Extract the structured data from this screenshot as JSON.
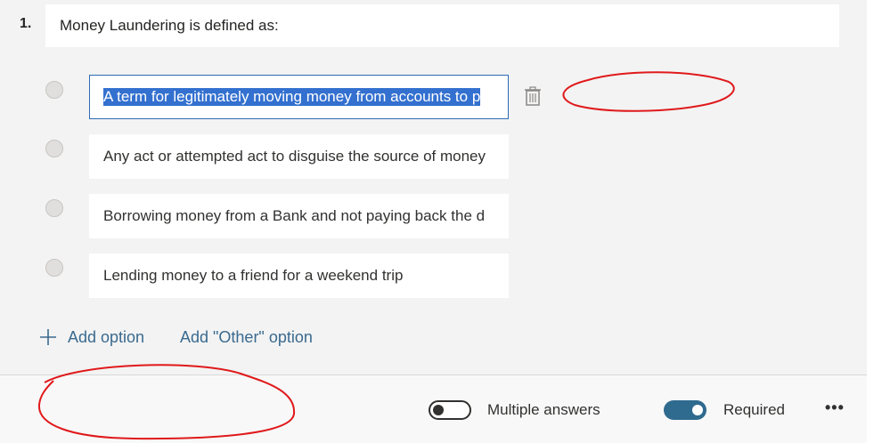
{
  "question": {
    "number": "1.",
    "title": "Money Laundering is defined as:"
  },
  "options": [
    {
      "text": "A term for legitimately moving money from accounts to p",
      "active": true
    },
    {
      "text": "Any act or attempted act to disguise the source of money",
      "active": false
    },
    {
      "text": "Borrowing money from a Bank and not paying back the d",
      "active": false
    },
    {
      "text": "Lending money to a friend for a weekend trip",
      "active": false
    }
  ],
  "actions": {
    "add_option": "Add option",
    "add_other": "Add \"Other\" option"
  },
  "footer": {
    "multiple_answers": "Multiple answers",
    "multiple_answers_on": false,
    "required": "Required",
    "required_on": true,
    "more": "•••"
  },
  "colors": {
    "accent": "#2f6a8f",
    "selection": "#3370cf",
    "annotation": "#e0191b"
  },
  "icons": [
    "delete-icon",
    "plus-icon",
    "more-icon"
  ]
}
